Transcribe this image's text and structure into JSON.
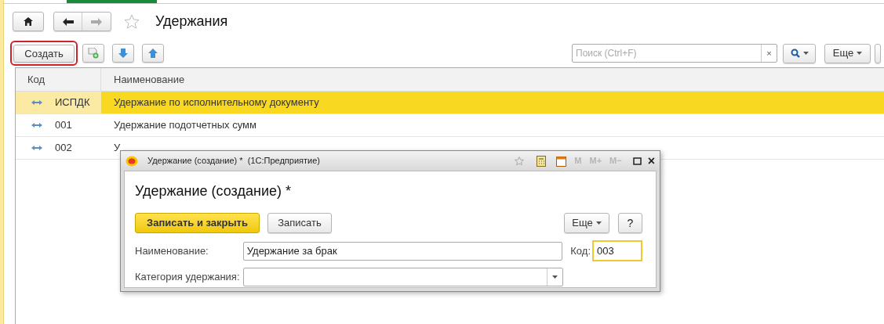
{
  "page": {
    "title": "Удержания",
    "favorite": false
  },
  "toolbar": {
    "create": "Создать",
    "search_placeholder": "Поиск (Ctrl+F)",
    "clear": "×",
    "more": "Еще"
  },
  "table": {
    "columns": [
      "Код",
      "Наименование"
    ],
    "rows": [
      {
        "code": "ИСПДК",
        "name": "Удержание по исполнительному документу",
        "selected": true
      },
      {
        "code": "001",
        "name": "Удержание подотчетных сумм",
        "selected": false
      },
      {
        "code": "002",
        "name": "У",
        "selected": false
      }
    ]
  },
  "dialog": {
    "window_title": "Удержание (создание) *  (1С:Предприятие)",
    "memory_buttons": [
      "M",
      "M+",
      "M−"
    ],
    "close": "×",
    "heading": "Удержание (создание) *",
    "buttons": {
      "save_close": "Записать и закрыть",
      "save": "Записать",
      "more": "Еще",
      "help": "?"
    },
    "fields": {
      "name_label": "Наименование:",
      "name_value": "Удержание за брак",
      "code_label": "Код:",
      "code_value": "003",
      "category_label": "Категория удержания:"
    }
  }
}
